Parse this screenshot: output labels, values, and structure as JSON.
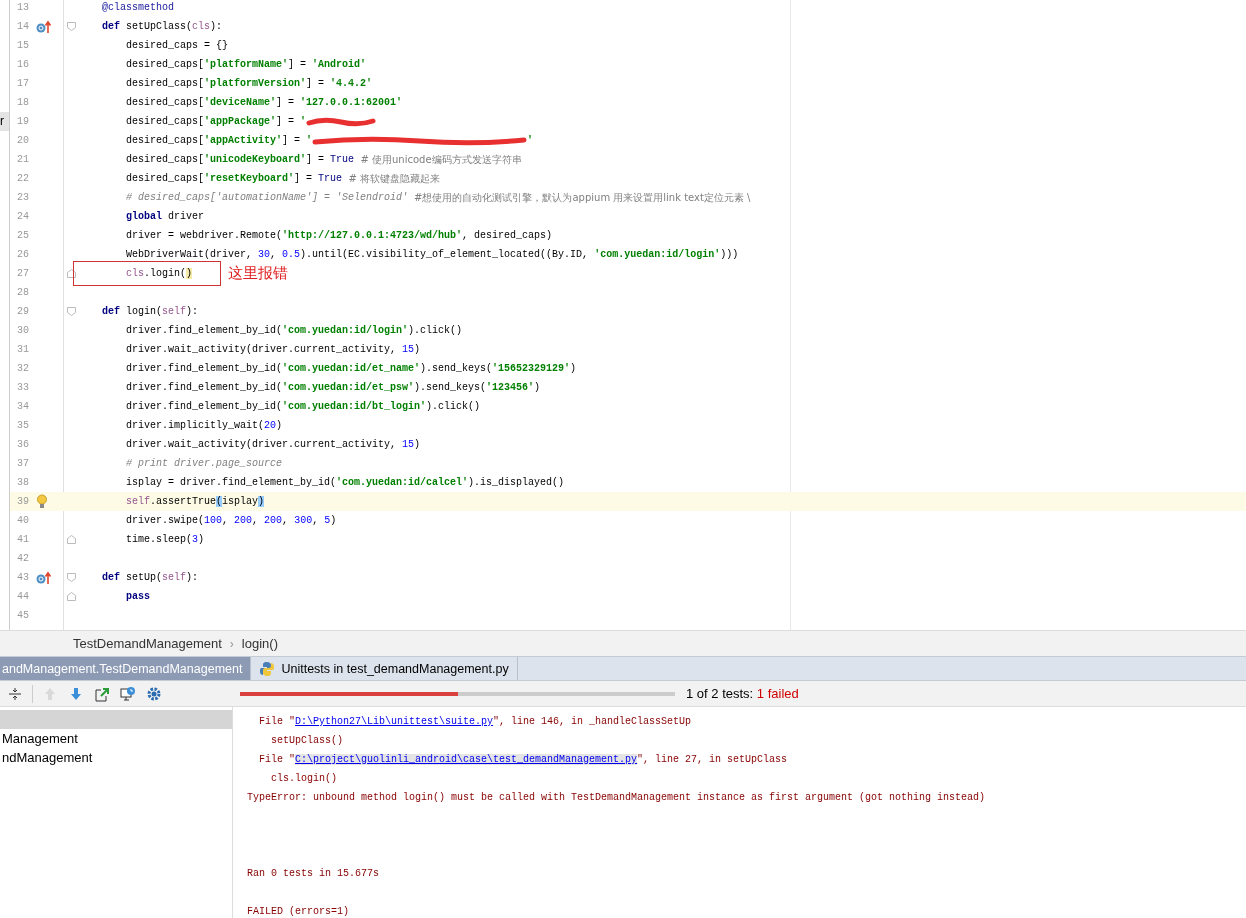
{
  "editor": {
    "edge_fragment": "r",
    "lines": [
      {
        "number": "13",
        "tokens": [
          {
            "kind": "dec",
            "text": "    @classmethod"
          }
        ]
      },
      {
        "number": "14",
        "gutter_icon": {
          "kind": "override"
        },
        "fold_marker": {
          "kind": "start"
        },
        "tokens": [
          {
            "kind": "kw",
            "text": "    def "
          },
          {
            "kind": "plain",
            "text": "setUpClass("
          },
          {
            "kind": "param",
            "text": "cls"
          },
          {
            "kind": "plain",
            "text": "):"
          }
        ]
      },
      {
        "number": "15",
        "tokens": [
          {
            "kind": "plain",
            "text": "        desired_caps = {}"
          }
        ]
      },
      {
        "number": "16",
        "tokens": [
          {
            "kind": "plain",
            "text": "        desired_caps["
          },
          {
            "kind": "str",
            "text": "'platformName'"
          },
          {
            "kind": "plain",
            "text": "] = "
          },
          {
            "kind": "str",
            "text": "'Android'"
          }
        ]
      },
      {
        "number": "17",
        "tokens": [
          {
            "kind": "plain",
            "text": "        desired_caps["
          },
          {
            "kind": "str",
            "text": "'platformVersion'"
          },
          {
            "kind": "plain",
            "text": "] = "
          },
          {
            "kind": "str",
            "text": "'4.4.2'"
          }
        ]
      },
      {
        "number": "18",
        "tokens": [
          {
            "kind": "plain",
            "text": "        desired_caps["
          },
          {
            "kind": "str",
            "text": "'deviceName'"
          },
          {
            "kind": "plain",
            "text": "] = "
          },
          {
            "kind": "str",
            "text": "'127.0.0.1:62001'"
          }
        ]
      },
      {
        "number": "19",
        "tokens": [
          {
            "kind": "plain",
            "text": "        desired_caps["
          },
          {
            "kind": "str",
            "text": "'appPackage'"
          },
          {
            "kind": "plain",
            "text": "] = "
          },
          {
            "kind": "str",
            "text": "'"
          },
          {
            "kind": "scribble",
            "long": false
          }
        ]
      },
      {
        "number": "20",
        "tokens": [
          {
            "kind": "plain",
            "text": "        desired_caps["
          },
          {
            "kind": "str",
            "text": "'appActivity'"
          },
          {
            "kind": "plain",
            "text": "] = "
          },
          {
            "kind": "str",
            "text": "'"
          },
          {
            "kind": "scribble",
            "long": true
          },
          {
            "kind": "str",
            "text": "'"
          }
        ]
      },
      {
        "number": "21",
        "tokens": [
          {
            "kind": "plain",
            "text": "        desired_caps["
          },
          {
            "kind": "str",
            "text": "'unicodeKeyboard'"
          },
          {
            "kind": "plain",
            "text": "] = "
          },
          {
            "kind": "const",
            "text": "True"
          },
          {
            "kind": "cjk",
            "text": "  # 使用unicode编码方式发送字符串"
          }
        ]
      },
      {
        "number": "22",
        "tokens": [
          {
            "kind": "plain",
            "text": "        desired_caps["
          },
          {
            "kind": "str",
            "text": "'resetKeyboard'"
          },
          {
            "kind": "plain",
            "text": "] = "
          },
          {
            "kind": "const",
            "text": "True"
          },
          {
            "kind": "cjk",
            "text": "  # 将软键盘隐藏起来"
          }
        ]
      },
      {
        "number": "23",
        "tokens": [
          {
            "kind": "comment",
            "text": "        # desired_caps['automationName'] = 'Selendroid' "
          },
          {
            "kind": "cjk",
            "text": "#想使用的自动化测试引擎，默认为appium 用来设置用link text定位元素 \\"
          }
        ]
      },
      {
        "number": "24",
        "tokens": [
          {
            "kind": "kw",
            "text": "        global "
          },
          {
            "kind": "plain",
            "text": "driver"
          }
        ]
      },
      {
        "number": "25",
        "tokens": [
          {
            "kind": "plain",
            "text": "        driver = webdriver.Remote("
          },
          {
            "kind": "str",
            "text": "'http://127.0.0.1:4723/wd/hub'"
          },
          {
            "kind": "plain",
            "text": ", desired_caps)"
          }
        ]
      },
      {
        "number": "26",
        "tokens": [
          {
            "kind": "plain",
            "text": "        WebDriverWait(driver, "
          },
          {
            "kind": "num",
            "text": "30"
          },
          {
            "kind": "plain",
            "text": ", "
          },
          {
            "kind": "num",
            "text": "0.5"
          },
          {
            "kind": "plain",
            "text": ").until(EC.visibility_of_element_located((By.ID, "
          },
          {
            "kind": "str",
            "text": "'com.yuedan:id/login'"
          },
          {
            "kind": "plain",
            "text": ")))"
          }
        ]
      },
      {
        "number": "27",
        "fold_marker": {
          "kind": "end"
        },
        "annotation": "这里报错",
        "tokens": [
          {
            "kind": "self",
            "text": "        cls"
          },
          {
            "kind": "plain",
            "text": ".login("
          },
          {
            "kind": "plain",
            "text": ")",
            "highlight": {
              "kind": "caret"
            }
          }
        ]
      },
      {
        "number": "28"
      },
      {
        "number": "29",
        "fold_marker": {
          "kind": "start"
        },
        "tokens": [
          {
            "kind": "kw",
            "text": "    def "
          },
          {
            "kind": "plain",
            "text": "login("
          },
          {
            "kind": "param",
            "text": "self"
          },
          {
            "kind": "plain",
            "text": "):"
          }
        ]
      },
      {
        "number": "30",
        "tokens": [
          {
            "kind": "plain",
            "text": "        driver.find_element_by_id("
          },
          {
            "kind": "str",
            "text": "'com.yuedan:id/login'"
          },
          {
            "kind": "plain",
            "text": ").click()"
          }
        ]
      },
      {
        "number": "31",
        "tokens": [
          {
            "kind": "plain",
            "text": "        driver.wait_activity(driver.current_activity, "
          },
          {
            "kind": "num",
            "text": "15"
          },
          {
            "kind": "plain",
            "text": ")"
          }
        ]
      },
      {
        "number": "32",
        "tokens": [
          {
            "kind": "plain",
            "text": "        driver.find_element_by_id("
          },
          {
            "kind": "str",
            "text": "'com.yuedan:id/et_name'"
          },
          {
            "kind": "plain",
            "text": ").send_keys("
          },
          {
            "kind": "str",
            "text": "'15652329129'"
          },
          {
            "kind": "plain",
            "text": ")"
          }
        ]
      },
      {
        "number": "33",
        "tokens": [
          {
            "kind": "plain",
            "text": "        driver.find_element_by_id("
          },
          {
            "kind": "str",
            "text": "'com.yuedan:id/et_psw'"
          },
          {
            "kind": "plain",
            "text": ").send_keys("
          },
          {
            "kind": "str",
            "text": "'123456'"
          },
          {
            "kind": "plain",
            "text": ")"
          }
        ]
      },
      {
        "number": "34",
        "tokens": [
          {
            "kind": "plain",
            "text": "        driver.find_element_by_id("
          },
          {
            "kind": "str",
            "text": "'com.yuedan:id/bt_login'"
          },
          {
            "kind": "plain",
            "text": ").click()"
          }
        ]
      },
      {
        "number": "35",
        "tokens": [
          {
            "kind": "plain",
            "text": "        driver.implicitly_wait("
          },
          {
            "kind": "num",
            "text": "20"
          },
          {
            "kind": "plain",
            "text": ")"
          }
        ]
      },
      {
        "number": "36",
        "tokens": [
          {
            "kind": "plain",
            "text": "        driver.wait_activity(driver.current_activity, "
          },
          {
            "kind": "num",
            "text": "15"
          },
          {
            "kind": "plain",
            "text": ")"
          }
        ]
      },
      {
        "number": "37",
        "tokens": [
          {
            "kind": "comment",
            "text": "        # print driver.page_source"
          }
        ]
      },
      {
        "number": "38",
        "tokens": [
          {
            "kind": "plain",
            "text": "        isplay = driver.find_element_by_id("
          },
          {
            "kind": "str",
            "text": "'com.yuedan:id/calcel'"
          },
          {
            "kind": "plain",
            "text": ").is_displayed()"
          }
        ]
      },
      {
        "number": "39",
        "current": true,
        "gutter_icon": {
          "kind": "bulb"
        },
        "tokens": [
          {
            "kind": "self",
            "text": "        self"
          },
          {
            "kind": "plain",
            "text": ".assertTrue"
          },
          {
            "kind": "plain",
            "text": "(",
            "highlight": {
              "kind": "paren"
            }
          },
          {
            "kind": "plain",
            "text": "isplay"
          },
          {
            "kind": "plain",
            "text": ")",
            "highlight": {
              "kind": "paren"
            }
          }
        ]
      },
      {
        "number": "40",
        "tokens": [
          {
            "kind": "plain",
            "text": "        driver.swipe("
          },
          {
            "kind": "num",
            "text": "100"
          },
          {
            "kind": "plain",
            "text": ", "
          },
          {
            "kind": "num",
            "text": "200"
          },
          {
            "kind": "plain",
            "text": ", "
          },
          {
            "kind": "num",
            "text": "200"
          },
          {
            "kind": "plain",
            "text": ", "
          },
          {
            "kind": "num",
            "text": "300"
          },
          {
            "kind": "plain",
            "text": ", "
          },
          {
            "kind": "num",
            "text": "5"
          },
          {
            "kind": "plain",
            "text": ")"
          }
        ]
      },
      {
        "number": "41",
        "fold_marker": {
          "kind": "end"
        },
        "tokens": [
          {
            "kind": "plain",
            "text": "        time.sleep("
          },
          {
            "kind": "num",
            "text": "3"
          },
          {
            "kind": "plain",
            "text": ")"
          }
        ]
      },
      {
        "number": "42"
      },
      {
        "number": "43",
        "gutter_icon": {
          "kind": "override"
        },
        "fold_marker": {
          "kind": "start"
        },
        "tokens": [
          {
            "kind": "kw",
            "text": "    def "
          },
          {
            "kind": "plain",
            "text": "setUp("
          },
          {
            "kind": "param",
            "text": "self"
          },
          {
            "kind": "plain",
            "text": "):"
          }
        ]
      },
      {
        "number": "44",
        "fold_marker": {
          "kind": "end"
        },
        "tokens": [
          {
            "kind": "kw",
            "text": "        pass"
          }
        ]
      },
      {
        "number": "45"
      }
    ]
  },
  "breadcrumb": {
    "items": [
      "TestDemandManagement",
      "login()"
    ],
    "separator": "›"
  },
  "run_tabs": [
    {
      "label": "andManagement.TestDemandManagement",
      "selected": true,
      "kind": "plain"
    },
    {
      "label": "Unittests in test_demandManagement.py",
      "selected": false,
      "kind": "python"
    }
  ],
  "toolbar": [
    {
      "kind": "collapse",
      "disabled": false
    },
    {
      "kind": "up",
      "disabled": true
    },
    {
      "kind": "down",
      "disabled": false
    },
    {
      "kind": "export",
      "disabled": false
    },
    {
      "kind": "history",
      "disabled": false
    },
    {
      "kind": "settings",
      "disabled": false
    }
  ],
  "progress": {
    "level": 0.5,
    "summary": "1 of 2 tests: ",
    "failed": "1 failed"
  },
  "tree": [
    {
      "selected": true
    },
    {
      "label": "Management",
      "selected": false
    },
    {
      "label": "ndManagement",
      "selected": false
    }
  ],
  "console": [
    {
      "kind": "text",
      "parts": [
        {
          "text": "  File \""
        },
        {
          "text": "D:\\Python27\\Lib\\unittest\\suite.py",
          "link": true
        },
        {
          "text": "\", line 146, in _handleClassSetUp"
        }
      ]
    },
    {
      "kind": "text",
      "parts": [
        {
          "text": "    setUpClass()"
        }
      ]
    },
    {
      "kind": "text",
      "parts": [
        {
          "text": "  File \""
        },
        {
          "text": "C:\\project\\guolinli_android\\case\\test_demandManagement.py",
          "link": true,
          "highlighted": true
        },
        {
          "text": "\", line 27, in setUpClass"
        }
      ]
    },
    {
      "kind": "text",
      "parts": [
        {
          "text": "    cls.login()"
        }
      ]
    },
    {
      "kind": "text",
      "parts": [
        {
          "text": "TypeError: unbound method login() must be called with TestDemandManagement instance as first argument (got nothing instead)"
        }
      ]
    },
    {
      "kind": "blank"
    },
    {
      "kind": "blank"
    },
    {
      "kind": "blank"
    },
    {
      "kind": "text",
      "parts": [
        {
          "text": "Ran 0 tests in 15.677s"
        }
      ]
    },
    {
      "kind": "blank"
    },
    {
      "kind": "text",
      "parts": [
        {
          "text": "FAILED (errors=1)"
        }
      ]
    }
  ]
}
